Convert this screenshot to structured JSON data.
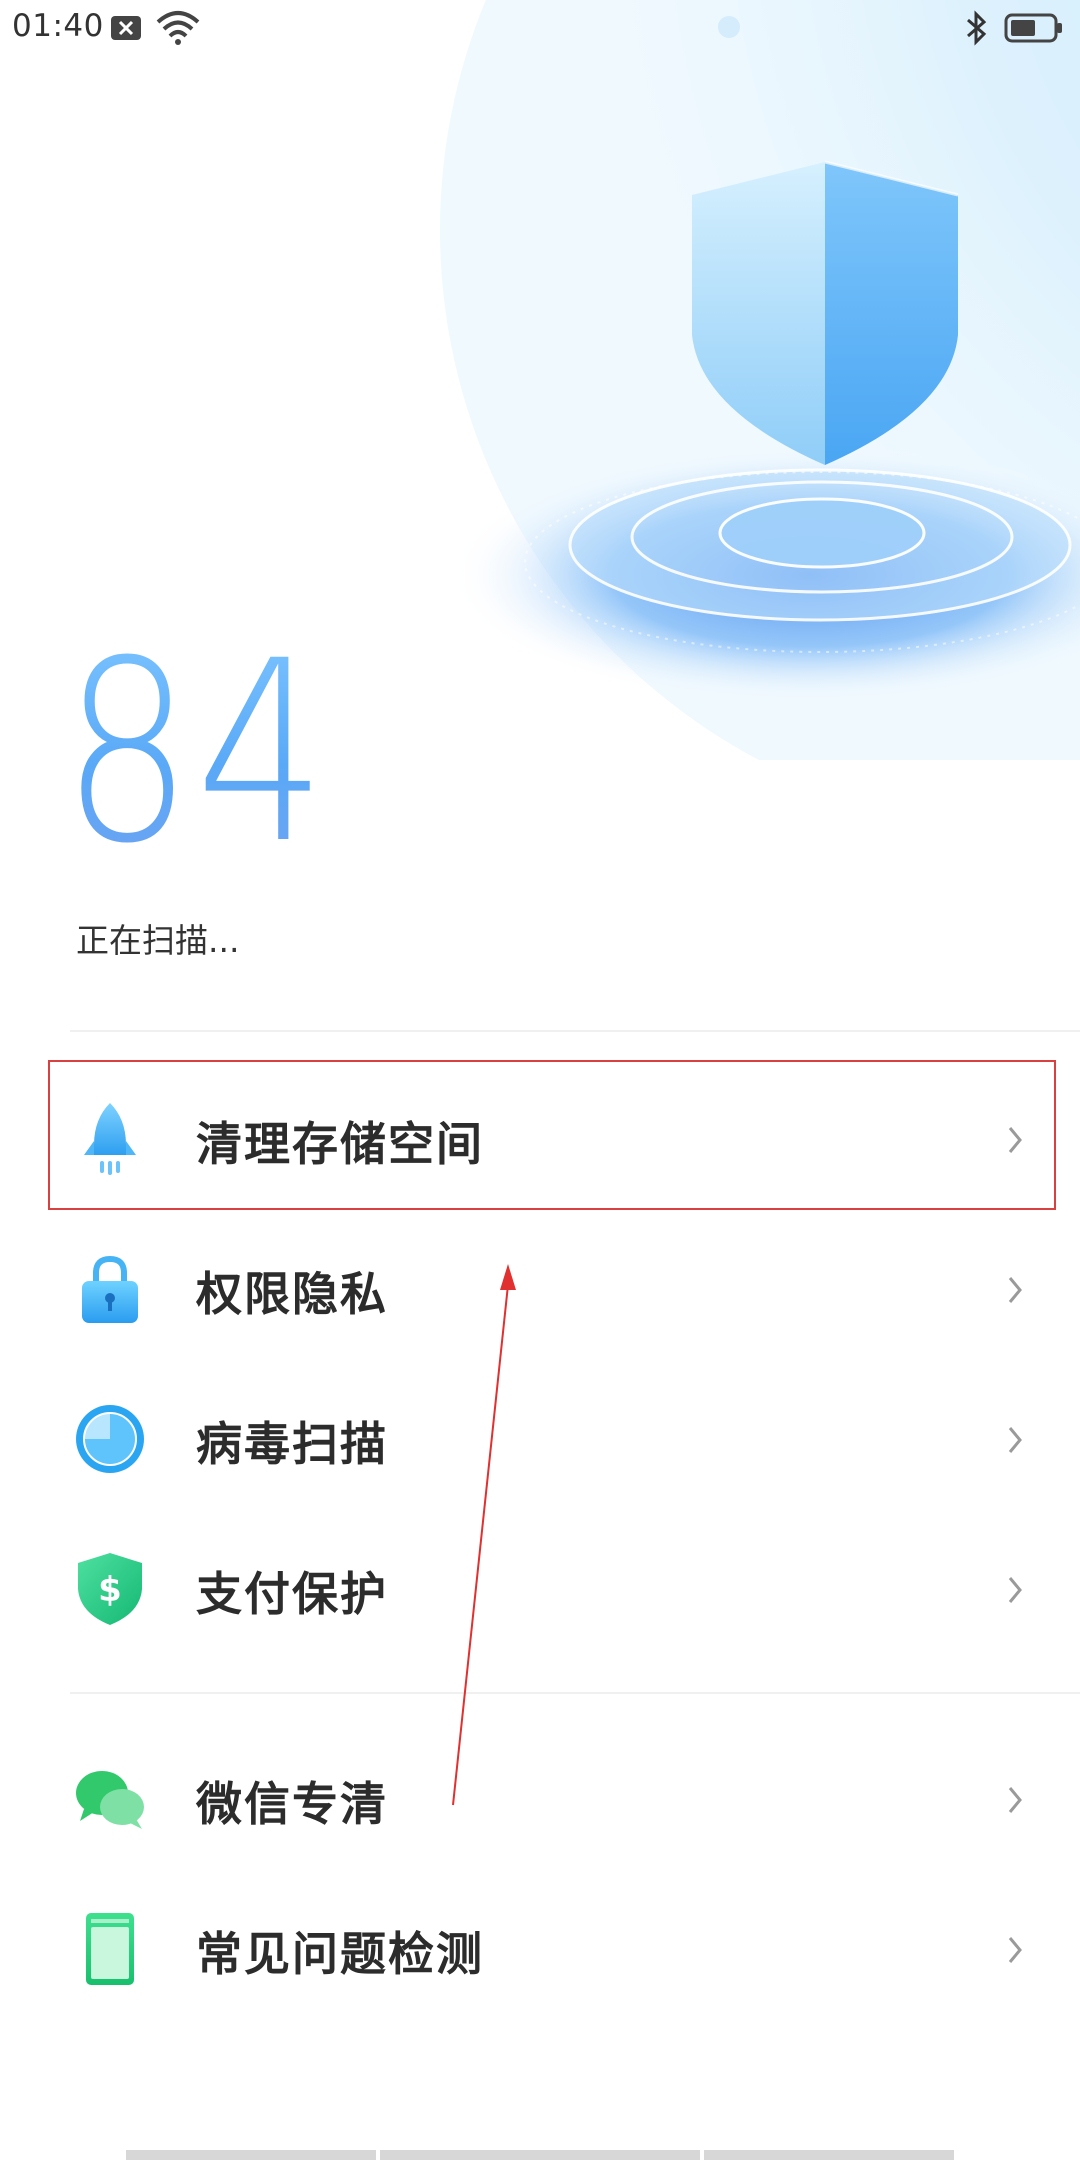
{
  "status_bar": {
    "time": "01:40",
    "icons": [
      "notification-x-icon",
      "wifi-icon",
      "bluetooth-icon",
      "battery-icon"
    ]
  },
  "score": {
    "value": "84",
    "status_text": "正在扫描..."
  },
  "menu": {
    "primary": [
      {
        "label": "清理存储空间",
        "icon": "rocket-icon"
      },
      {
        "label": "权限隐私",
        "icon": "lock-icon"
      },
      {
        "label": "病毒扫描",
        "icon": "scan-icon"
      },
      {
        "label": "支付保护",
        "icon": "payment-shield-icon"
      }
    ],
    "secondary": [
      {
        "label": "微信专清",
        "icon": "wechat-icon"
      },
      {
        "label": "常见问题检测",
        "icon": "phone-check-icon"
      }
    ]
  },
  "colors": {
    "accent": "#5aa9f7",
    "annotation": "#d94040",
    "text": "#2c2c2c"
  }
}
